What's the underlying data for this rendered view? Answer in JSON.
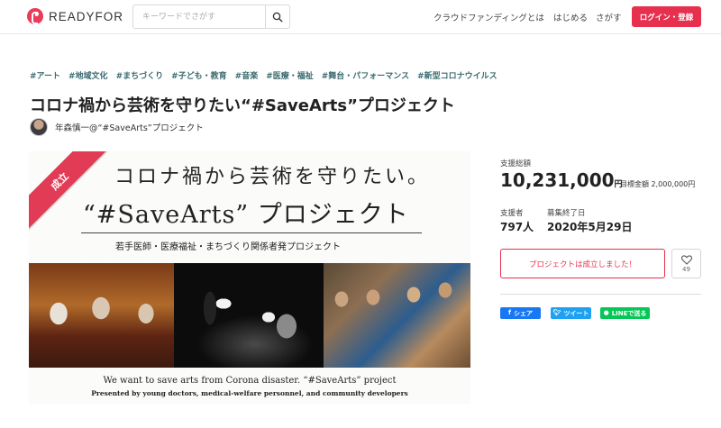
{
  "header": {
    "logo_text": "READYFOR",
    "search_placeholder": "キーワードでさがす",
    "nav": [
      "クラウドファンディングとは",
      "はじめる",
      "さがす"
    ],
    "login_label": "ログイン・登録"
  },
  "project": {
    "tags": [
      "#アート",
      "#地域文化",
      "#まちづくり",
      "#子ども・教育",
      "#音楽",
      "#医療・福祉",
      "#舞台・パフォーマンス",
      "#新型コロナウイルス"
    ],
    "title": "コロナ禍から芸術を守りたい“#SaveArts”プロジェクト",
    "owner_name": "年森慎一@“#SaveArts”プロジェクト"
  },
  "hero": {
    "badge": "成立",
    "line1": "コロナ禍から芸術を守りたい。",
    "line2": "“#SaveArts” プロジェクト",
    "subtitle": "若手医師・医療福祉・まちづくり関係者発プロジェクト",
    "english1": "We want to save arts from Corona disaster. “#SaveArts” project",
    "english2": "Presented by young doctors, medical-welfare personnel, and community developers"
  },
  "stats": {
    "total_label": "支援総額",
    "total_amount": "10,231,000",
    "total_unit": "円",
    "goal_text": "目標金額 2,000,000円",
    "supporters_label": "支援者",
    "supporters_value": "797人",
    "end_label": "募集終了日",
    "end_value": "2020年5月29日"
  },
  "actions": {
    "success_text": "プロジェクトは成立しました！",
    "favorite_count": "49"
  },
  "share": {
    "facebook": "シェア",
    "twitter": "ツイート",
    "line": "LINEで送る"
  },
  "colors": {
    "brand": "#e6304e",
    "tag": "#3a6b70",
    "facebook": "#1877f2",
    "twitter": "#1da1f2",
    "line": "#06c755"
  }
}
